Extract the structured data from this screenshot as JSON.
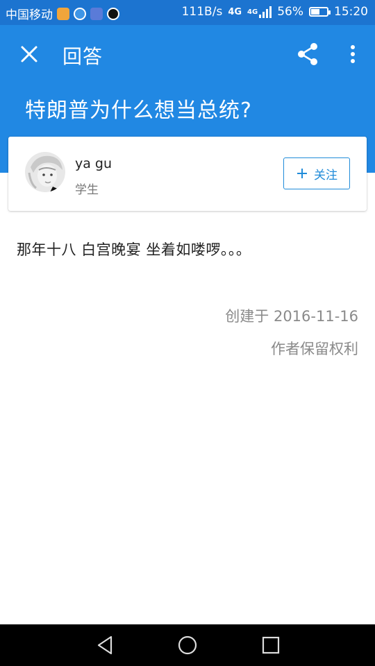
{
  "status_bar": {
    "carrier": "中国移动",
    "app_icons": [
      "app-icon-1",
      "app-icon-2",
      "app-icon-3",
      "qq-icon"
    ],
    "net_speed": "111B/s",
    "network_1": "4G",
    "network_2": "4G",
    "battery": "56%",
    "battery_level": 0.56,
    "time": "15:20"
  },
  "header": {
    "title": "回答",
    "question": "特朗普为什么想当总统?",
    "background": "#2188e3"
  },
  "author": {
    "name": "ya gu",
    "title": "学生",
    "follow_label": "关注"
  },
  "answer": {
    "text": "那年十八 白宫晚宴 坐着如喽啰。。。",
    "created": "创建于 2016-11-16",
    "rights": "作者保留权利"
  },
  "colors": {
    "accent": "#1f8bd9",
    "status_bar": "#1c74d0"
  }
}
